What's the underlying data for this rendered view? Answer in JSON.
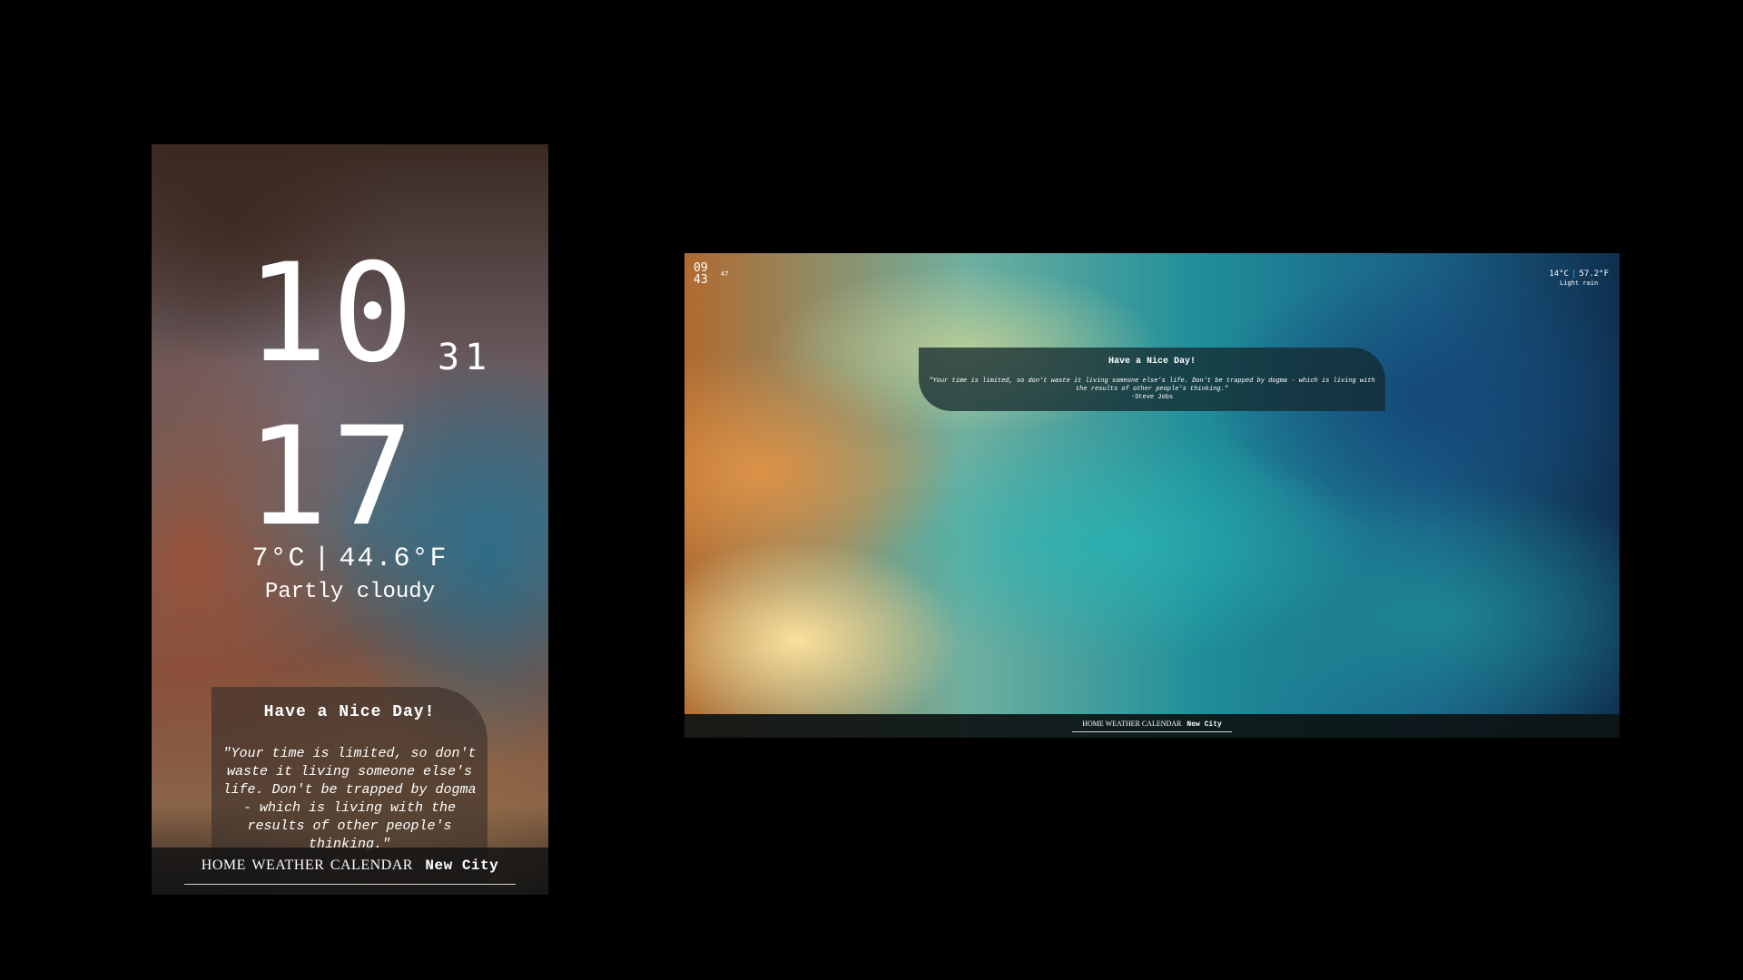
{
  "mobile": {
    "clock": {
      "hours": "10",
      "minutes": "17",
      "seconds": "31"
    },
    "weather": {
      "celsius": "7°C",
      "separator": "|",
      "fahrenheit": "44.6°F",
      "condition": "Partly cloudy"
    },
    "quote": {
      "title": "Have a Nice Day!",
      "text": "\"Your time is limited, so don't waste it living someone else's life. Don't be trapped by dogma - which is living with the results of other people's thinking.\""
    },
    "nav": {
      "home": "HOME",
      "weather": "WEATHER",
      "calendar": "CALENDAR",
      "city": "New City"
    }
  },
  "desktop": {
    "clock": {
      "hours": "09",
      "minutes": "43",
      "seconds": "47"
    },
    "weather": {
      "celsius": "14°C",
      "separator": "|",
      "fahrenheit": "57.2°F",
      "condition": "Light rain"
    },
    "quote": {
      "title": "Have a Nice Day!",
      "text": "\"Your time is limited, so don't waste it living someone else's life. Don't be trapped by dogma - which is living with the results of other people's thinking.\"",
      "author": "-Steve Jobs"
    },
    "nav": {
      "home": "HOME",
      "weather": "WEATHER",
      "calendar": "CALENDAR",
      "city": "New City"
    }
  }
}
